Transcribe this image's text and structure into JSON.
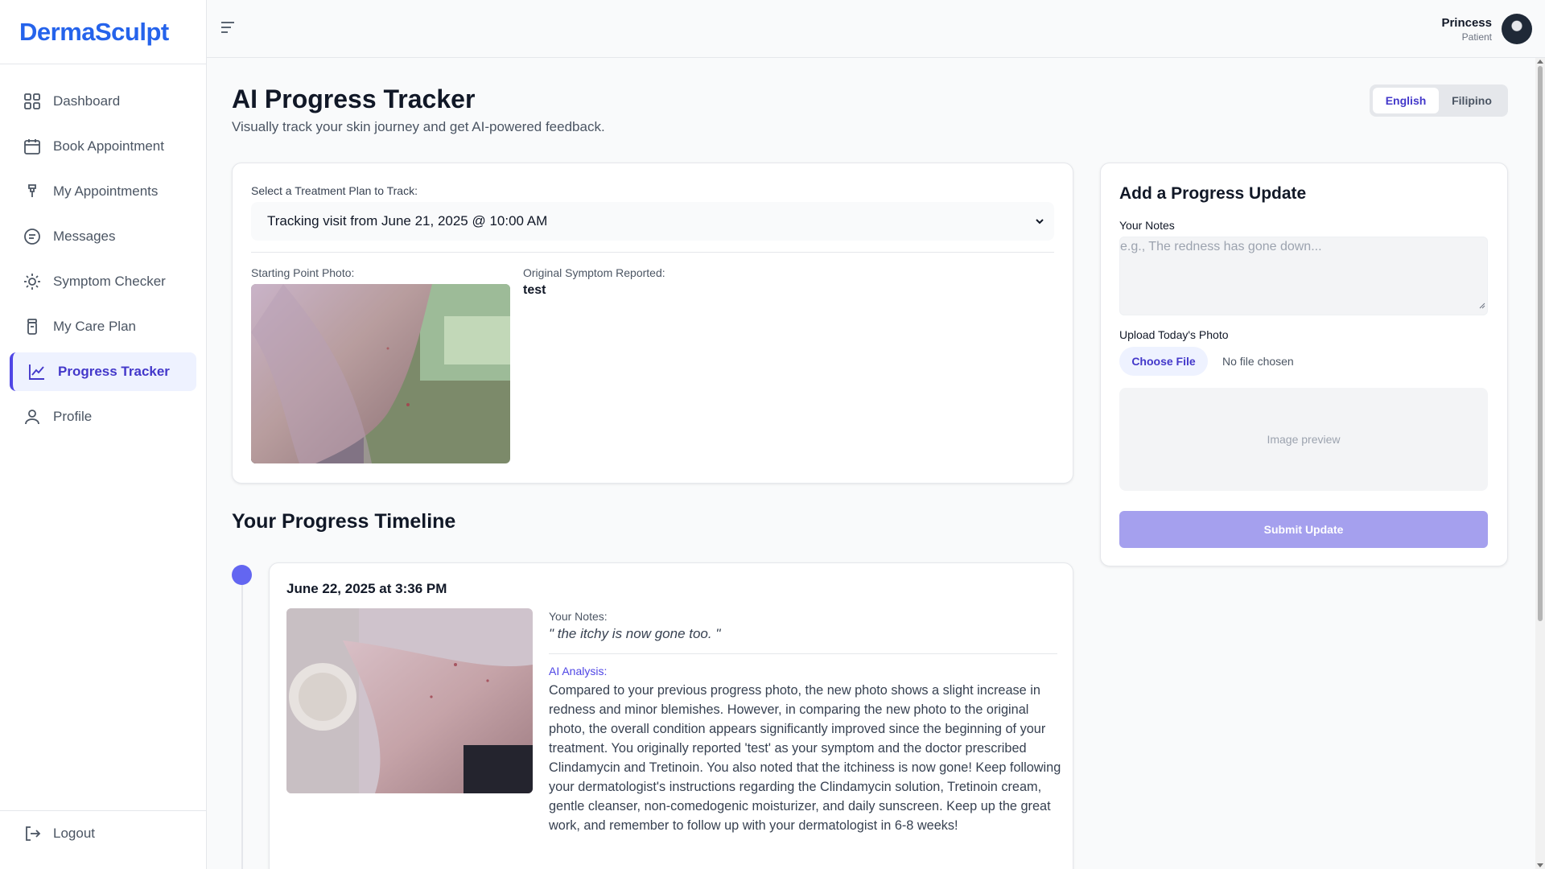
{
  "app": {
    "brand": "DermaSculpt"
  },
  "sidebar": {
    "items": [
      {
        "label": "Dashboard",
        "icon": "grid-icon"
      },
      {
        "label": "Book Appointment",
        "icon": "calendar-icon"
      },
      {
        "label": "My Appointments",
        "icon": "clipboard-icon"
      },
      {
        "label": "Messages",
        "icon": "chat-icon"
      },
      {
        "label": "Symptom Checker",
        "icon": "sun-icon"
      },
      {
        "label": "My Care Plan",
        "icon": "bottle-icon"
      },
      {
        "label": "Progress Tracker",
        "icon": "chart-line-icon",
        "active": true
      },
      {
        "label": "Profile",
        "icon": "user-icon"
      }
    ],
    "logout": "Logout"
  },
  "user": {
    "name": "Princess",
    "role": "Patient"
  },
  "page": {
    "title": "AI Progress Tracker",
    "subtitle": "Visually track your skin journey and get AI-powered feedback.",
    "languages": [
      "English",
      "Filipino"
    ],
    "selected_language": "English"
  },
  "plan": {
    "select_label": "Select a Treatment Plan to Track:",
    "selected": "Tracking visit from June 21, 2025 @ 10:00 AM",
    "start_photo_label": "Starting Point Photo:",
    "symptom_label": "Original Symptom Reported:",
    "symptom_value": "test"
  },
  "timeline": {
    "title": "Your Progress Timeline",
    "entries": [
      {
        "date": "June 22, 2025 at 3:36 PM",
        "notes_label": "Your Notes:",
        "notes": "\" the itchy is now gone too. \"",
        "ai_label": "AI Analysis:",
        "ai_text": "Compared to your previous progress photo, the new photo shows a slight increase in redness and minor blemishes. However, in comparing the new photo to the original photo, the overall condition appears significantly improved since the beginning of your treatment. You originally reported 'test' as your symptom and the doctor prescribed Clindamycin and Tretinoin. You also noted that the itchiness is now gone! Keep following your dermatologist's instructions regarding the Clindamycin solution, Tretinoin cream, gentle cleanser, non-comedogenic moisturizer, and daily sunscreen. Keep up the great work, and remember to follow up with your dermatologist in 6-8 weeks!"
      }
    ]
  },
  "update": {
    "title": "Add a Progress Update",
    "notes_label": "Your Notes",
    "notes_placeholder": "e.g., The redness has gone down...",
    "photo_label": "Upload Today's Photo",
    "file_button": "Choose File",
    "file_status": "No file chosen",
    "preview_text": "Image preview",
    "submit": "Submit Update"
  },
  "colors": {
    "brand": "#2563eb",
    "accent": "#4f46e5",
    "submit_disabled": "#a5a0ee"
  }
}
